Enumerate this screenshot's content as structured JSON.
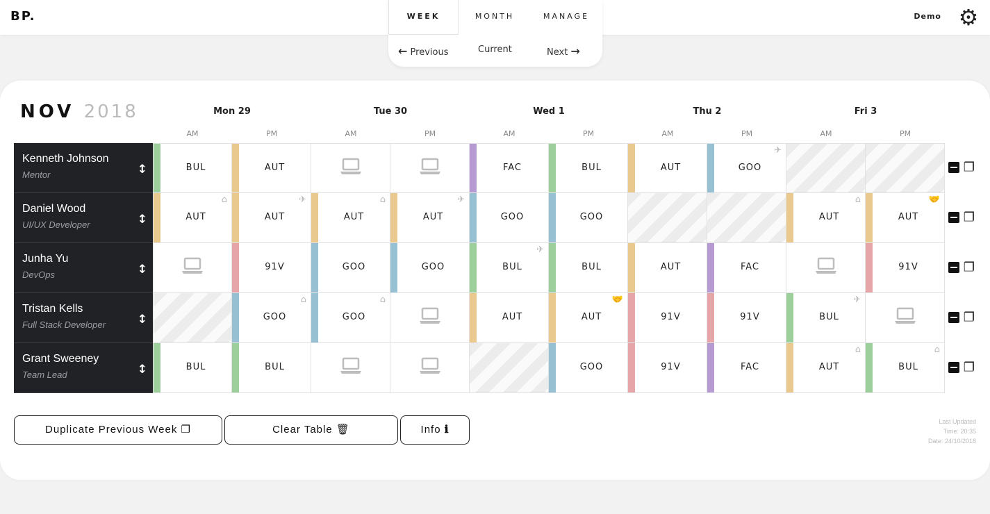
{
  "app": {
    "logo": "BP.",
    "user": "Demo"
  },
  "nav": {
    "tabs": [
      "WEEK",
      "MONTH",
      "MANAGE"
    ],
    "active": "WEEK",
    "previous": "Previous",
    "current": "Current",
    "next": "Next"
  },
  "calendar": {
    "month": "NOV",
    "year": "2018",
    "days": [
      "Mon 29",
      "Tue 30",
      "Wed 1",
      "Thu 2",
      "Fri 3"
    ],
    "halves": [
      "AM",
      "PM"
    ]
  },
  "colors": {
    "BUL": "#9ccf9c",
    "AUT": "#e9c98d",
    "FAC": "#b69bd3",
    "GOO": "#97c0d3",
    "91V": "#e6a5a8"
  },
  "people": [
    {
      "name": "Kenneth Johnson",
      "role": "Mentor",
      "cells": [
        {
          "code": "BUL"
        },
        {
          "code": "AUT"
        },
        {
          "type": "laptop"
        },
        {
          "type": "laptop"
        },
        {
          "code": "FAC"
        },
        {
          "code": "BUL"
        },
        {
          "code": "AUT"
        },
        {
          "code": "GOO",
          "icon": "plane"
        },
        {
          "type": "empty"
        },
        {
          "type": "empty"
        }
      ]
    },
    {
      "name": "Daniel Wood",
      "role": "UI/UX Developer",
      "cells": [
        {
          "code": "AUT",
          "icon": "home"
        },
        {
          "code": "AUT",
          "icon": "plane"
        },
        {
          "code": "AUT",
          "icon": "home"
        },
        {
          "code": "AUT",
          "icon": "plane"
        },
        {
          "code": "GOO"
        },
        {
          "code": "GOO"
        },
        {
          "type": "empty"
        },
        {
          "type": "empty"
        },
        {
          "code": "AUT",
          "icon": "home"
        },
        {
          "code": "AUT",
          "icon": "handshake"
        }
      ]
    },
    {
      "name": "Junha Yu",
      "role": "DevOps",
      "cells": [
        {
          "type": "laptop"
        },
        {
          "code": "91V"
        },
        {
          "code": "GOO"
        },
        {
          "code": "GOO"
        },
        {
          "code": "BUL",
          "icon": "plane"
        },
        {
          "code": "BUL"
        },
        {
          "code": "AUT"
        },
        {
          "code": "FAC"
        },
        {
          "type": "laptop"
        },
        {
          "code": "91V"
        }
      ]
    },
    {
      "name": "Tristan Kells",
      "role": "Full Stack Developer",
      "cells": [
        {
          "type": "empty"
        },
        {
          "code": "GOO",
          "icon": "home"
        },
        {
          "code": "GOO",
          "icon": "home"
        },
        {
          "type": "laptop"
        },
        {
          "code": "AUT"
        },
        {
          "code": "AUT",
          "icon": "handshake"
        },
        {
          "code": "91V"
        },
        {
          "code": "91V"
        },
        {
          "code": "BUL",
          "icon": "plane"
        },
        {
          "type": "laptop"
        }
      ]
    },
    {
      "name": "Grant Sweeney",
      "role": "Team Lead",
      "cells": [
        {
          "code": "BUL"
        },
        {
          "code": "BUL"
        },
        {
          "type": "laptop"
        },
        {
          "type": "laptop"
        },
        {
          "type": "empty"
        },
        {
          "code": "GOO"
        },
        {
          "code": "91V"
        },
        {
          "code": "FAC"
        },
        {
          "code": "AUT",
          "icon": "home"
        },
        {
          "code": "BUL",
          "icon": "home"
        }
      ]
    }
  ],
  "buttons": {
    "duplicate": "Duplicate Previous Week",
    "clear": "Clear Table",
    "info": "Info"
  },
  "updated": {
    "label": "Last Updated",
    "time": "Time: 20:35",
    "date": "Date: 24/10/2018"
  }
}
